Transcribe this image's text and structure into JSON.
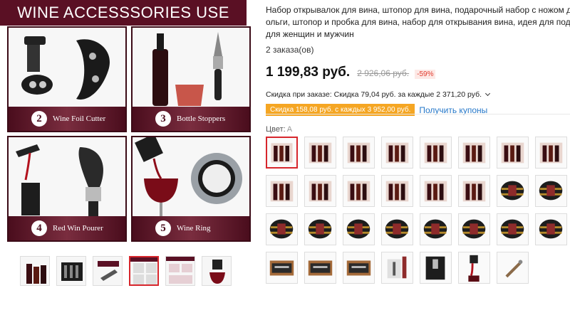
{
  "main_image": {
    "banner": "WINE ACCESSSORIES USE MANU",
    "panels": [
      {
        "number": "",
        "caption": ""
      },
      {
        "number": "",
        "caption": ""
      },
      {
        "number": "2",
        "caption": "Wine Foil Cutter"
      },
      {
        "number": "3",
        "caption": "Bottle Stoppers"
      },
      {
        "number": "4",
        "caption": "Red Win Pourer"
      },
      {
        "number": "5",
        "caption": "Wine Ring"
      }
    ]
  },
  "gallery": {
    "thumbnails": [
      "bottles",
      "box-set",
      "corkscrew",
      "usage-manual",
      "usage-manual-2",
      "pourer"
    ],
    "active_index": 3
  },
  "product": {
    "title_line1": "Набор открывалок для вина, штопор для вина, подарочный набор с ножом для ф",
    "title_line2": "ольги, штопор и пробка для вина, набор для открывания вина, идея для подарка",
    "title_line3": "для женщин и мужчин",
    "orders": "2 заказа(ов)",
    "price": "1 199,83 руб.",
    "old_price": "2 926,06 руб.",
    "discount": "-59%",
    "store_discount": "Скидка при заказе: Скидка 79,04 руб. за каждые 2 371,20 руб.",
    "coupon_tag": "Скидка 158,08 руб. с каждых 3 952,00 руб.",
    "coupon_link": "Получить купоны",
    "color_label": "Цвет:",
    "color_value": "A"
  },
  "swatches": [
    "bottles-box",
    "bottles-box",
    "bottles-box",
    "bottles-box",
    "bottles-box",
    "bottles-box",
    "bottles-box",
    "bottles-box",
    "bottles-box",
    "bottles-box",
    "bottles-box",
    "bottles-box",
    "bottles-box",
    "bottles-box",
    "barrel",
    "barrel",
    "barrel",
    "barrel",
    "barrel",
    "barrel",
    "barrel",
    "barrel",
    "barrel",
    "barrel",
    "wood-case",
    "wood-case",
    "wood-case",
    "standing-tool",
    "pourer-box",
    "pourer",
    "corkscrew"
  ],
  "selected_swatch": 0,
  "colors": {
    "accent": "#d7262c",
    "banner": "#5a1024",
    "coupon": "#f5a623",
    "link": "#2678c9"
  }
}
